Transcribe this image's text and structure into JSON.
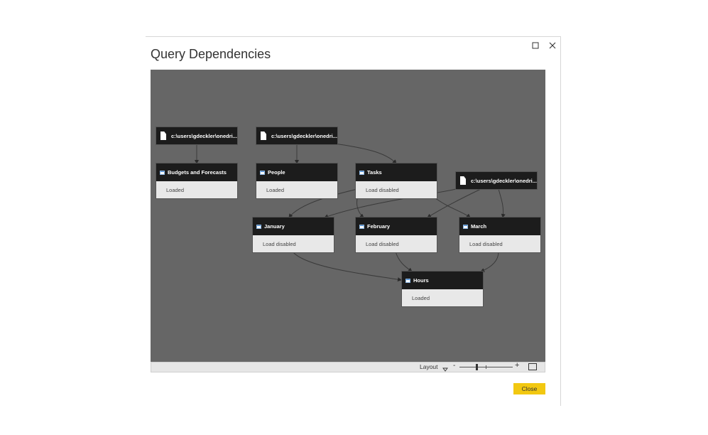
{
  "dialog": {
    "title": "Query Dependencies",
    "close_label": "Close"
  },
  "window_controls": {
    "maximize_icon": "maximize-icon",
    "close_icon": "close-icon"
  },
  "sources": [
    {
      "id": "src1",
      "label": "c:\\users\\gdeckler\\onedri..."
    },
    {
      "id": "src2",
      "label": "c:\\users\\gdeckler\\onedri..."
    },
    {
      "id": "src3",
      "label": "c:\\users\\gdeckler\\onedri..."
    }
  ],
  "queries": [
    {
      "id": "budgets",
      "name": "Budgets and Forecasts",
      "status": "Loaded"
    },
    {
      "id": "people",
      "name": "People",
      "status": "Loaded"
    },
    {
      "id": "tasks",
      "name": "Tasks",
      "status": "Load disabled"
    },
    {
      "id": "january",
      "name": "January",
      "status": "Load disabled"
    },
    {
      "id": "february",
      "name": "February",
      "status": "Load disabled"
    },
    {
      "id": "march",
      "name": "March",
      "status": "Load disabled"
    },
    {
      "id": "hours",
      "name": "Hours",
      "status": "Loaded"
    }
  ],
  "statusbar": {
    "layout_label": "Layout",
    "zoom_minus": "-",
    "zoom_plus": "+"
  },
  "colors": {
    "canvas_bg": "#666666",
    "node_header": "#1c1c1c",
    "node_body": "#e8e8e8",
    "close_button": "#f2c811"
  }
}
